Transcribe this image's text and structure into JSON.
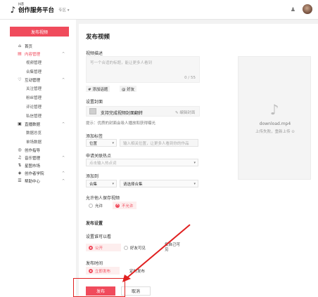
{
  "header": {
    "logo_small": "抖音",
    "logo_title": "创作服务平台",
    "zone": "专区 ▾",
    "bell_icon": "bell-icon",
    "avatar_icon": "avatar"
  },
  "sidebar": {
    "publish_label": "发布视频",
    "items": [
      {
        "type": "item",
        "icon": "⌂",
        "icon_name": "home-icon",
        "label": "首页",
        "chev": "",
        "active": false
      },
      {
        "type": "item",
        "icon": "▤",
        "icon_name": "content-icon",
        "label": "内容管理",
        "chev": "^",
        "active": true
      },
      {
        "type": "sub",
        "label": "视频管理"
      },
      {
        "type": "sub",
        "label": "合集管理"
      },
      {
        "type": "item",
        "icon": "♡",
        "icon_name": "interact-icon",
        "label": "互动管理",
        "chev": "^",
        "active": false
      },
      {
        "type": "sub",
        "label": "关注管理"
      },
      {
        "type": "sub",
        "label": "粉丝管理"
      },
      {
        "type": "sub",
        "label": "评论管理"
      },
      {
        "type": "sub",
        "label": "私信管理"
      },
      {
        "type": "item",
        "icon": "▣",
        "icon_name": "data-icon",
        "label": "直播数据",
        "chev": "^",
        "active": false
      },
      {
        "type": "sub",
        "label": "数据总览"
      },
      {
        "type": "sub",
        "label": "单场数据"
      },
      {
        "type": "item",
        "icon": "◎",
        "icon_name": "guide-icon",
        "label": "创作指导",
        "chev": "",
        "active": false
      },
      {
        "type": "item",
        "icon": "♫",
        "icon_name": "music-icon",
        "label": "音乐管理",
        "chev": "^",
        "active": false
      },
      {
        "type": "item",
        "icon": "⇅",
        "icon_name": "market-icon",
        "label": "星图市场",
        "chev": "",
        "active": false
      },
      {
        "type": "item",
        "icon": "◈",
        "icon_name": "academy-icon",
        "label": "创作者学院",
        "chev": "^",
        "active": false
      },
      {
        "type": "item",
        "icon": "☰",
        "icon_name": "help-icon",
        "label": "帮助中心",
        "chev": "^",
        "active": false
      }
    ]
  },
  "form": {
    "title": "发布视频",
    "desc_label": "视频描述",
    "desc_placeholder": "写一个合适的标题，能让更多人看到",
    "desc_count": "0 / 55",
    "hashtag_btn": "# 添加话题",
    "mention_btn": "@ 好友",
    "cover_label": "设置封面",
    "cover_text": "支持完成视频封面翻转",
    "cover_edit": "✎ 编辑封面",
    "cover_hint": "提示：优质的封面会吸人播放和获得曝光",
    "tag_label": "添加标签",
    "tag_select": "位置",
    "tag_input_ph": "输入相关位置，让更多人看到你的作品",
    "hotspot_label": "申请关联热点",
    "hotspot_ph": "点击输入热点词",
    "to_label": "添加到",
    "to_select": "合集",
    "to_select2": "请选择合集",
    "allow_label": "允许他人保存视频",
    "allow_yes": "允许",
    "allow_no": "不允许",
    "publish_settings": "发布设置",
    "who_label": "设置谁可以看",
    "who_public": "公开",
    "who_friends": "好友可见",
    "who_self": "仅自己可见",
    "time_label": "发布时间",
    "time_now": "立即发布",
    "time_sched": "定时发布",
    "submit": "发布",
    "cancel": "取消"
  },
  "preview": {
    "filename": "download.mp4",
    "meta": "上传失败，重新上传 ⊙"
  },
  "colors": {
    "accent": "#f04b5c",
    "annotation": "#e02020"
  }
}
